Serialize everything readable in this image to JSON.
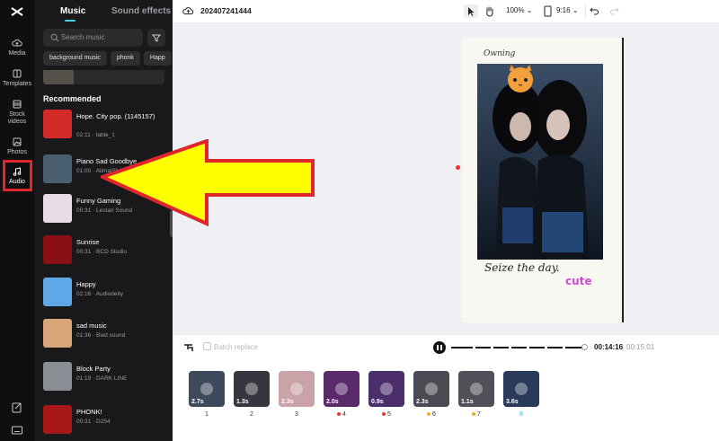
{
  "rail": {
    "items": [
      {
        "label": "Media",
        "icon": "cloud-upload-icon"
      },
      {
        "label": "Templates",
        "icon": "templates-icon"
      },
      {
        "label": "Stock videos",
        "icon": "film-icon"
      },
      {
        "label": "Photos",
        "icon": "image-icon"
      },
      {
        "label": "Audio",
        "icon": "music-note-icon",
        "active": true
      }
    ]
  },
  "panel": {
    "tabs": {
      "music": "Music",
      "sound_effects": "Sound effects"
    },
    "search_placeholder": "Search music",
    "chips": [
      "background music",
      "phonk",
      "Happ"
    ],
    "section_title": "Recommended",
    "tracks": [
      {
        "title": "Hope. City pop. (1145157)",
        "meta": "02:11 · table_1",
        "color": "#d42a2a"
      },
      {
        "title": "Piano Sad Goodbye",
        "meta": "01:00 · AlimalSf",
        "color": "#4a5f70"
      },
      {
        "title": "Funny Gaming",
        "meta": "00:31 · Lestari Sound",
        "color": "#e8dce4"
      },
      {
        "title": "Sunrise",
        "meta": "00:31 · BCD Studio",
        "color": "#8a0f12"
      },
      {
        "title": "Happy",
        "meta": "02:16 · Audiodeity",
        "color": "#5fa8e8"
      },
      {
        "title": "sad music",
        "meta": "01:36 · Bwd sound",
        "color": "#d9a679"
      },
      {
        "title": "Block Party",
        "meta": "01:19 · DARK LINE",
        "color": "#8a8f95"
      },
      {
        "title": "PHONK!",
        "meta": "00:31 · D254",
        "color": "#a81818"
      }
    ]
  },
  "topbar": {
    "project_title": "202407241444",
    "zoom": "100%",
    "ratio": "9:16"
  },
  "canvas": {
    "sign_top": "Owning",
    "sign_bottom": "Seize the day.",
    "sign_cute": "cute"
  },
  "player": {
    "batch_replace": "Batch replace",
    "current_time": "00:14:16",
    "separator": "|",
    "total_time": "00:15:01"
  },
  "timeline": {
    "clips": [
      {
        "num": "1",
        "dur": "2.7s",
        "dot": "",
        "color": "#3c4a5c"
      },
      {
        "num": "2",
        "dur": "1.3s",
        "dot": "",
        "color": "#35363e"
      },
      {
        "num": "3",
        "dur": "2.3s",
        "dot": "",
        "color": "#c9a3a8"
      },
      {
        "num": "4",
        "dur": "2.0s",
        "dot": "#e33",
        "color": "#5a2a6a"
      },
      {
        "num": "5",
        "dur": "0.9s",
        "dot": "#e33",
        "color": "#4c2e6a"
      },
      {
        "num": "6",
        "dur": "2.3s",
        "dot": "#e8b020",
        "color": "#4a4a52"
      },
      {
        "num": "7",
        "dur": "1.1s",
        "dot": "#e8b020",
        "color": "#505058"
      },
      {
        "num": "8",
        "dur": "3.6s",
        "dot": "",
        "color": "#2a3a5a",
        "numColor": "#3ab4e6"
      }
    ]
  }
}
